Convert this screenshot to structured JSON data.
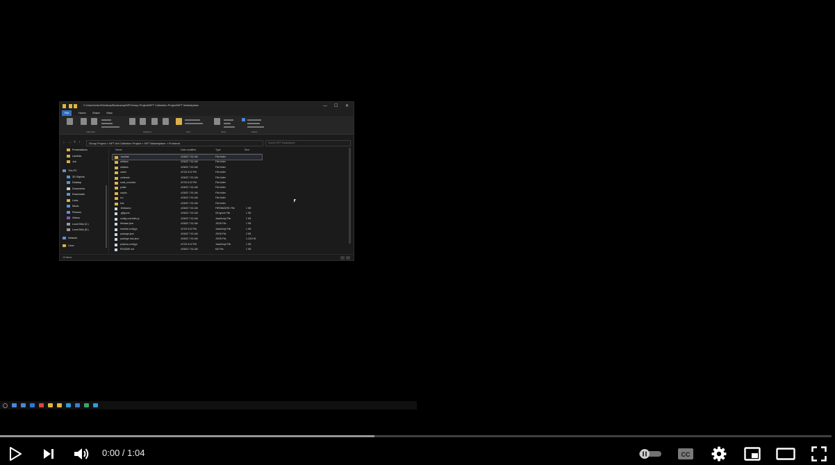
{
  "explorer": {
    "title": "C:\\Users\\User\\Desktop\\Bootcamp\\WF\\Group Project\\NFT Collection Project\\NFT Marketplace",
    "window_buttons": [
      "—",
      "☐",
      "✕"
    ],
    "menu": [
      "File",
      "Home",
      "Share",
      "View"
    ],
    "ribbon_groups": [
      "Clipboard",
      "Organize",
      "New",
      "Open",
      "Select"
    ],
    "path": "Group Project  >  NFT Art Collection Project  >  NFT Marketplace  >  Frontend",
    "search_placeholder": "Search NFT Marketplace",
    "sidebar": [
      {
        "label": "Presentations",
        "color": "#d9b14a"
      },
      {
        "label": "Lambda",
        "color": "#d9b14a"
      },
      {
        "label": "Job",
        "color": "#d9b14a"
      },
      {
        "label": "This PC",
        "color": "#5b93d6"
      },
      {
        "label": "3D Objects",
        "color": "#5b93d6"
      },
      {
        "label": "Desktop",
        "color": "#5b93d6"
      },
      {
        "label": "Documents",
        "color": "#c9c9c9"
      },
      {
        "label": "Downloads",
        "color": "#5b93d6"
      },
      {
        "label": "Links",
        "color": "#d9b14a"
      },
      {
        "label": "Music",
        "color": "#5b93d6"
      },
      {
        "label": "Pictures",
        "color": "#5b93d6"
      },
      {
        "label": "Videos",
        "color": "#7a56c9"
      },
      {
        "label": "Local Disk (C:)",
        "color": "#9a9a9a"
      },
      {
        "label": "Local Disk (D:)",
        "color": "#9a9a9a"
      },
      {
        "label": "Network",
        "color": "#5b93d6"
      },
      {
        "label": "Linux",
        "color": "#d9b14a"
      }
    ],
    "columns": [
      "Name",
      "Date modified",
      "Type",
      "Size"
    ],
    "rows": [
      {
        "name": ".hardhat",
        "date": "4/26/22 7:51 AM",
        "type": "File folder",
        "size": "",
        "folder": true
      },
      {
        "name": "artifacts",
        "date": "4/26/22 7:51 AM",
        "type": "File folder",
        "size": "",
        "folder": true
      },
      {
        "name": "artifacts",
        "date": "4/26/22 7:51 AM",
        "type": "File folder",
        "size": "",
        "folder": true
      },
      {
        "name": "cache",
        "date": "4/7/22 6:22 PM",
        "type": "File folder",
        "size": "",
        "folder": true
      },
      {
        "name": "contracts",
        "date": "4/26/22 7:51 AM",
        "type": "File folder",
        "size": "",
        "folder": true
      },
      {
        "name": "node_modules",
        "date": "4/7/22 6:22 PM",
        "type": "File folder",
        "size": "",
        "folder": true
      },
      {
        "name": "public",
        "date": "4/26/22 7:51 AM",
        "type": "File folder",
        "size": "",
        "folder": true
      },
      {
        "name": "scripts",
        "date": "4/26/22 7:51 AM",
        "type": "File folder",
        "size": "",
        "folder": true
      },
      {
        "name": "src",
        "date": "4/26/22 7:51 AM",
        "type": "File folder",
        "size": "",
        "folder": true
      },
      {
        "name": "test",
        "date": "4/26/22 7:51 AM",
        "type": "File folder",
        "size": "",
        "folder": true
      },
      {
        "name": ".firebaserc",
        "date": "4/26/22 7:51 AM",
        "type": "FIREBASERC File",
        "size": "1 KB",
        "folder": false
      },
      {
        "name": ".gitignore",
        "date": "4/26/22 7:51 AM",
        "type": "Git Ignore File",
        "size": "1 KB",
        "folder": false
      },
      {
        "name": "config-overrides.js",
        "date": "4/26/22 7:51 AM",
        "type": "JavaScript File",
        "size": "1 KB",
        "folder": false
      },
      {
        "name": "firebase.json",
        "date": "4/26/22 7:51 AM",
        "type": "JSON File",
        "size": "1 KB",
        "folder": false
      },
      {
        "name": "hardhat.config.js",
        "date": "4/7/22 6:22 PM",
        "type": "JavaScript File",
        "size": "1 KB",
        "folder": false
      },
      {
        "name": "package.json",
        "date": "4/26/22 7:51 AM",
        "type": "JSON File",
        "size": "2 KB",
        "folder": false
      },
      {
        "name": "package-lock.json",
        "date": "4/26/22 7:51 AM",
        "type": "JSON File",
        "size": "1,100 KB",
        "folder": false
      },
      {
        "name": "postcss.config.js",
        "date": "4/7/22 6:22 PM",
        "type": "JavaScript File",
        "size": "1 KB",
        "folder": false
      },
      {
        "name": "README.md",
        "date": "4/26/22 7:51 AM",
        "type": "MD File",
        "size": "1 KB",
        "folder": false
      }
    ],
    "status": "19 items"
  },
  "taskbar_icon_colors": [
    "#888",
    "#4a86d8",
    "#4a86d8",
    "#2a7ad5",
    "#d64a3a",
    "#e0b640",
    "#e0b640",
    "#2e9bdb",
    "#3f7ad0",
    "#3ea36b",
    "#2e9bdb"
  ],
  "player": {
    "time_current": "0:00",
    "time_separator": " / ",
    "time_total": "1:04",
    "played_fraction": 0.0,
    "buffered_fraction": 0.45,
    "accent_color": "#ff0000",
    "controls_left": [
      "play-icon",
      "next-icon",
      "volume-icon"
    ],
    "controls_right": [
      "autoplay-toggle-icon",
      "captions-icon",
      "settings-gear-icon",
      "miniplayer-icon",
      "theater-mode-icon",
      "fullscreen-icon"
    ]
  }
}
